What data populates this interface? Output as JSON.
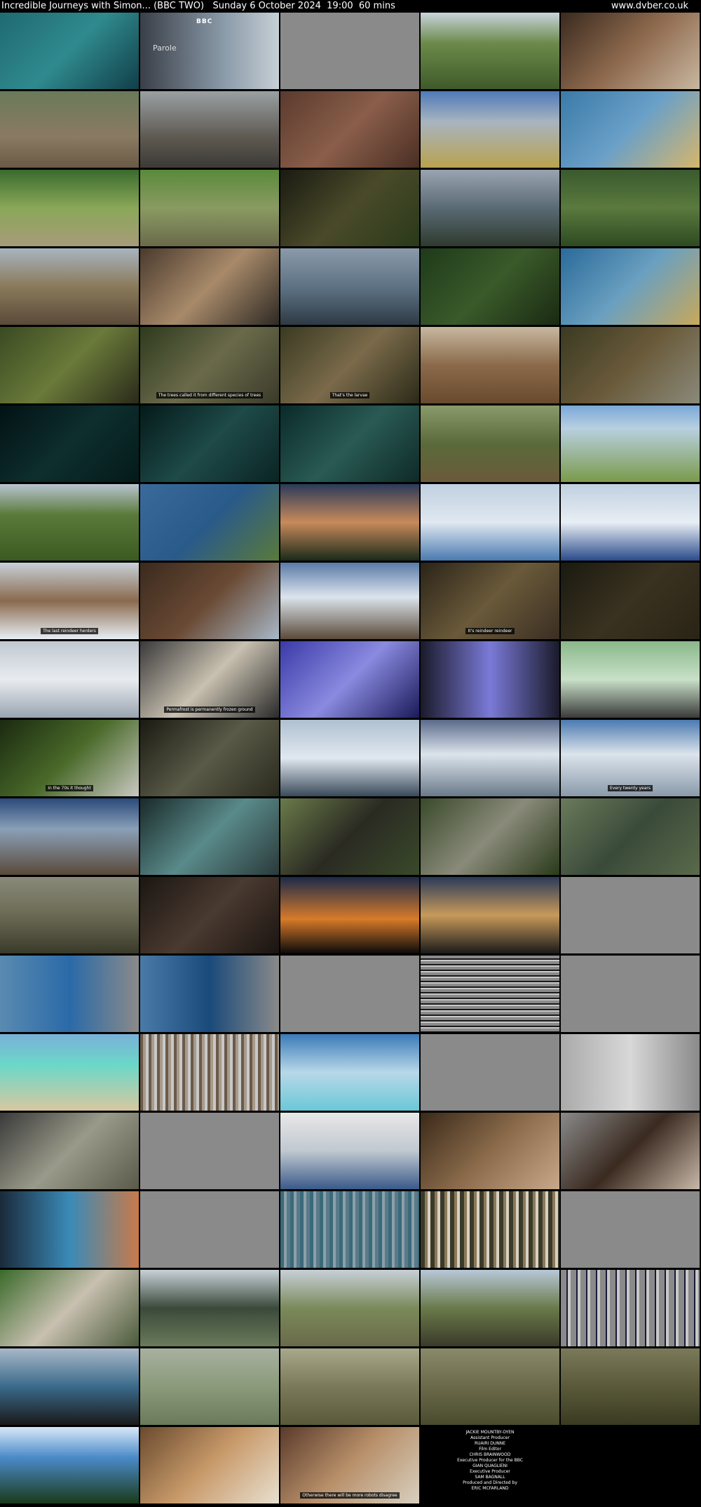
{
  "header": {
    "title": "Incredible Journeys with Simon... (BBC TWO)   Sunday 6 October 2024  19:00  60 mins",
    "site": "www.dvber.co.uk"
  },
  "grid": {
    "columns": 5,
    "rows": 19,
    "thumbs": [
      {
        "bg": "linear-gradient(135deg,#1f6a72,#2f8a8e 50%,#123e48)",
        "cap": ""
      },
      {
        "bg": "linear-gradient(90deg,#3a3f48,#8a9aa8 60%,#c6cfd6)",
        "cap": "",
        "logo": "BBC",
        "label": "Parole"
      },
      {
        "bg": "#8a8a8a",
        "cap": ""
      },
      {
        "bg": "linear-gradient(180deg,#c9d3dc,#6c8a4a 40%,#3f5a2a)",
        "cap": ""
      },
      {
        "bg": "linear-gradient(135deg,#3a2a1e,#8e6a4e 50%,#c9b7a0)",
        "cap": ""
      },
      {
        "bg": "linear-gradient(180deg,#6a7a5a,#8a7a62 60%,#6a5a46)",
        "cap": ""
      },
      {
        "bg": "linear-gradient(180deg,#9aa0a2,#5e5a52 60%,#3c3a36)",
        "cap": ""
      },
      {
        "bg": "linear-gradient(135deg,#5a3a2e,#8a5e4a 50%,#4a2e24)",
        "cap": ""
      },
      {
        "bg": "linear-gradient(180deg,#4e7ab8,#a8b4c0 40%,#b9a24e)",
        "cap": ""
      },
      {
        "bg": "linear-gradient(135deg,#3a7aa8,#6aa0c8 50%,#d6b66a)",
        "cap": ""
      },
      {
        "bg": "linear-gradient(180deg,#3a6a2e,#8aa858 50%,#a89a7a)",
        "cap": ""
      },
      {
        "bg": "linear-gradient(180deg,#5a8a3a,#8a9a62 50%,#6a6a4a)",
        "cap": ""
      },
      {
        "bg": "linear-gradient(135deg,#1a1a12,#4a4a2a 50%,#2a3a1a)",
        "cap": ""
      },
      {
        "bg": "linear-gradient(180deg,#9aa4b0,#5a6a74 50%,#2e3a2e)",
        "cap": ""
      },
      {
        "bg": "linear-gradient(180deg,#3a5a2e,#5a7a3e 50%,#2e4a22)",
        "cap": ""
      },
      {
        "bg": "linear-gradient(180deg,#a8b4c0,#8a7a5a 50%,#5a4a3a)",
        "cap": ""
      },
      {
        "bg": "linear-gradient(135deg,#4a3a2e,#a88a6a 50%,#2e2a24)",
        "cap": ""
      },
      {
        "bg": "linear-gradient(180deg,#8a9aaa,#5a6e80 55%,#2e3a44)",
        "cap": ""
      },
      {
        "bg": "linear-gradient(135deg,#1e3a1a,#3a5a2a 50%,#1a2a12)",
        "cap": ""
      },
      {
        "bg": "linear-gradient(135deg,#2a6a9a,#6aa0c0 50%,#c8a85a)",
        "cap": ""
      },
      {
        "bg": "linear-gradient(135deg,#3a4a22,#6a7a3a 50%,#2a2a1a)",
        "cap": ""
      },
      {
        "bg": "linear-gradient(135deg,#2e3a1e,#6a6a4a 50%,#3a3a2a)",
        "cap": "The trees called it from different species of trees"
      },
      {
        "bg": "linear-gradient(135deg,#3a3a22,#7a6a4a 50%,#2a2a18)",
        "cap": "That's the larvae"
      },
      {
        "bg": "linear-gradient(180deg,#c8b8a0,#8a6a4a 50%,#6a4a2e)",
        "cap": ""
      },
      {
        "bg": "linear-gradient(135deg,#3a3a22,#6a5a3a 50%,#8a8a7a)",
        "cap": ""
      },
      {
        "bg": "linear-gradient(135deg,#021214,#0e2e2e 50%,#041a1a)",
        "cap": ""
      },
      {
        "bg": "linear-gradient(135deg,#041a1a,#1e4a48 50%,#0a2424)",
        "cap": ""
      },
      {
        "bg": "linear-gradient(135deg,#0a2a2a,#2a5a54 50%,#0e2a28)",
        "cap": ""
      },
      {
        "bg": "linear-gradient(180deg,#8a9a6a,#5a6a3a 50%,#6a5a3a)",
        "cap": ""
      },
      {
        "bg": "linear-gradient(180deg,#7aa8d8,#b8d0e0 30%,#7a9a4a)",
        "cap": ""
      },
      {
        "bg": "linear-gradient(180deg,#b8c4d0,#5a7a3a 40%,#3a5a22)",
        "cap": ""
      },
      {
        "bg": "linear-gradient(135deg,#3a6a9a,#2a5a8a 50%,#5a7a3a)",
        "cap": ""
      },
      {
        "bg": "linear-gradient(180deg,#2a3a5a,#c88a5a 50%,#1a2a1a)",
        "cap": ""
      },
      {
        "bg": "linear-gradient(180deg,#c0d0e0,#e0e8f0 50%,#4a7ab0)",
        "cap": ""
      },
      {
        "bg": "linear-gradient(180deg,#c0d0e0,#e8eef4 50%,#2a4a8a)",
        "cap": ""
      },
      {
        "bg": "linear-gradient(180deg,#c8d0d8,#8a6a4e 50%,#e8eef4)",
        "cap": "The last reindeer herders"
      },
      {
        "bg": "linear-gradient(135deg,#3a2a1e,#6a4a34 50%,#a8b8c8)",
        "cap": ""
      },
      {
        "bg": "linear-gradient(180deg,#5a7aa8,#dce4ec 45%,#5a4a3a)",
        "cap": ""
      },
      {
        "bg": "linear-gradient(135deg,#2a2418,#6a5a3a 50%,#3a2e22)",
        "cap": "It's reindeer reindeer"
      },
      {
        "bg": "linear-gradient(135deg,#1a1a10,#3a3220 50%,#2a2416)",
        "cap": ""
      },
      {
        "bg": "linear-gradient(180deg,#c0c8d0,#e8ecf0 50%,#9aa4b0)",
        "cap": ""
      },
      {
        "bg": "linear-gradient(135deg,#3a3a3a,#c8c0b0 50%,#2a2a2a)",
        "cap": "Permafrost is permanently frozen ground"
      },
      {
        "bg": "linear-gradient(135deg,#3a3aa8,#8a8ae0 50%,#1a1a5a)",
        "cap": ""
      },
      {
        "bg": "linear-gradient(90deg,#1a1a2a,#7a7ad8 50%,#1a1a2a)",
        "cap": ""
      },
      {
        "bg": "linear-gradient(180deg,#8ab88a,#c8e0c8 50%,#3a3a3a)",
        "cap": ""
      },
      {
        "bg": "linear-gradient(135deg,#1a2a10,#4a6a2a 50%,#c8c8c0)",
        "cap": "In the 70s it thought"
      },
      {
        "bg": "linear-gradient(135deg,#1a1a12,#5a5a48 50%,#2a2a1e)",
        "cap": ""
      },
      {
        "bg": "linear-gradient(180deg,#b0c0d0,#e0e8f0 50%,#3a4a5a)",
        "cap": ""
      },
      {
        "bg": "linear-gradient(180deg,#5a6a8a,#dce4ec 45%,#6a7a8a)",
        "cap": ""
      },
      {
        "bg": "linear-gradient(180deg,#4a7ab0,#dce4ec 45%,#8a9aaa)",
        "cap": "Every twenty years"
      },
      {
        "bg": "linear-gradient(180deg,#2a4a7a,#8aa0b8 40%,#5a4a3a)",
        "cap": ""
      },
      {
        "bg": "linear-gradient(135deg,#1a2a2a,#5a8a8a 50%,#2a3a3a)",
        "cap": ""
      },
      {
        "bg": "linear-gradient(135deg,#6a7a4a,#2a2a22 50%,#3a4a2a)",
        "cap": ""
      },
      {
        "bg": "linear-gradient(135deg,#3a4a2a,#8a8a7a 50%,#2a3a1a)",
        "cap": ""
      },
      {
        "bg": "linear-gradient(135deg,#6a7a5a,#3a4a3a 50%,#5a6a4a)",
        "cap": ""
      },
      {
        "bg": "linear-gradient(180deg,#8a8a7a,#6a6a54 50%,#3a3a2a)",
        "cap": ""
      },
      {
        "bg": "linear-gradient(135deg,#1a1612,#4a3a30 50%,#1a1410)",
        "cap": ""
      },
      {
        "bg": "linear-gradient(180deg,#1a2a4a,#d87a2a 55%,#0a0a0a)",
        "cap": ""
      },
      {
        "bg": "linear-gradient(180deg,#2a3a5a,#c89a5a 50%,#1a1a1a)",
        "cap": ""
      },
      {
        "bg": "#8a8a8a",
        "cap": ""
      },
      {
        "bg": "linear-gradient(90deg,#5a8ab0,#2a6aa8 50%,#8a8a8a)",
        "cap": ""
      },
      {
        "bg": "linear-gradient(90deg,#4a7aa8,#1a4a7a 50%,#8a8a8a)",
        "cap": ""
      },
      {
        "bg": "#8a8a8a",
        "cap": ""
      },
      {
        "bg": "repeating-linear-gradient(180deg,#8a8a8a 0 4px,#1a1a1a 4px 6px,#c8c8c8 6px 8px)",
        "cap": ""
      },
      {
        "bg": "#8a8a8a",
        "cap": ""
      },
      {
        "bg": "linear-gradient(180deg,#7ab0d8,#6ad8c8 40%,#d8c8a0)",
        "cap": ""
      },
      {
        "bg": "repeating-linear-gradient(90deg,#6a5a4a 0 4px,#a89a8a 4px 8px,#c8c8c8 8px 12px)",
        "cap": ""
      },
      {
        "bg": "linear-gradient(180deg,#3a7ab8,#b8d8e8 50%,#6ac8d8)",
        "cap": ""
      },
      {
        "bg": "#8a8a8a",
        "cap": ""
      },
      {
        "bg": "linear-gradient(90deg,#aaaaaa,#d8d8d8 50%,#8a8a8a)",
        "cap": ""
      },
      {
        "bg": "linear-gradient(135deg,#3a3a3a,#9a9a8a 50%,#5a5a4a)",
        "cap": ""
      },
      {
        "bg": "#8a8a8a",
        "cap": ""
      },
      {
        "bg": "linear-gradient(180deg,#e8e8e8,#c0c8d0 50%,#3a5a8a)",
        "cap": ""
      },
      {
        "bg": "linear-gradient(135deg,#3a2a1a,#8a6a4a 50%,#c8a88a)",
        "cap": ""
      },
      {
        "bg": "linear-gradient(135deg,#8a8a8a,#3a2a20 50%,#c8b8a8)",
        "cap": ""
      },
      {
        "bg": "linear-gradient(90deg,#1a2a3a,#3a8ab8 50%,#c87a4a)",
        "cap": ""
      },
      {
        "bg": "#8a8a8a",
        "cap": ""
      },
      {
        "bg": "repeating-linear-gradient(90deg,#3a6a7a 0 5px,#8aa0a8 5px 9px,#5a7a8a 9px 14px)",
        "cap": ""
      },
      {
        "bg": "repeating-linear-gradient(90deg,#3a3a2a 0 6px,#8a7a5a 6px 10px,#d8d0c0 10px 14px)",
        "cap": ""
      },
      {
        "bg": "#8a8a8a",
        "cap": ""
      },
      {
        "bg": "linear-gradient(135deg,#3a6a2a,#c8c0b0 50%,#4a5a3a)",
        "cap": ""
      },
      {
        "bg": "linear-gradient(180deg,#c8d0d8,#3a4a3a 50%,#6a7a5a)",
        "cap": ""
      },
      {
        "bg": "linear-gradient(180deg,#c8d0d8,#7a8a5a 50%,#6a6a4a)",
        "cap": ""
      },
      {
        "bg": "linear-gradient(180deg,#b8c8d8,#6a7a4a 50%,#3a3a2a)",
        "cap": ""
      },
      {
        "bg": "repeating-linear-gradient(90deg,#8a8a8a 0 8px,#1a1a3a 8px 10px,#c8c8c8 10px 14px)",
        "cap": ""
      },
      {
        "bg": "linear-gradient(180deg,#a8b8c8,#3a6a8a 50%,#1a1a1a)",
        "cap": ""
      },
      {
        "bg": "linear-gradient(180deg,#a8b0a0,#8a9a7a 50%,#6a7a5a)",
        "cap": ""
      },
      {
        "bg": "linear-gradient(180deg,#a8a88a,#7a7a5a 50%,#5a5a3a)",
        "cap": ""
      },
      {
        "bg": "linear-gradient(180deg,#8a8a6a,#6a6a4a 50%,#4a4a2e)",
        "cap": ""
      },
      {
        "bg": "linear-gradient(180deg,#7a7a5a,#5a5a3a 50%,#3a3a22)",
        "cap": ""
      },
      {
        "bg": "linear-gradient(180deg,#d8e8f8,#4a8ac8 40%,#1a3a1a)",
        "cap": ""
      },
      {
        "bg": "linear-gradient(135deg,#6a4a2e,#c89a6a 50%,#e8e0d0)",
        "cap": ""
      },
      {
        "bg": "linear-gradient(135deg,#5a3a2a,#b8906a 50%,#d8d0c0)",
        "cap": "Otherwise there will be more robots disagree"
      },
      {
        "bg": "#000",
        "cap": "",
        "credits": [
          "JACKIE MOUNTBY-OYEN",
          "Assistant Producer",
          "RUAIRI DUNNE",
          "Film Editor",
          "CHRIS BRAINWOOD",
          "Executive Producer for the BBC",
          "GIAN QUAGLIENI",
          "Executive Producer",
          "SAM BAGNALL",
          "Produced and Directed by",
          "ERIC MCFARLAND"
        ]
      }
    ]
  }
}
